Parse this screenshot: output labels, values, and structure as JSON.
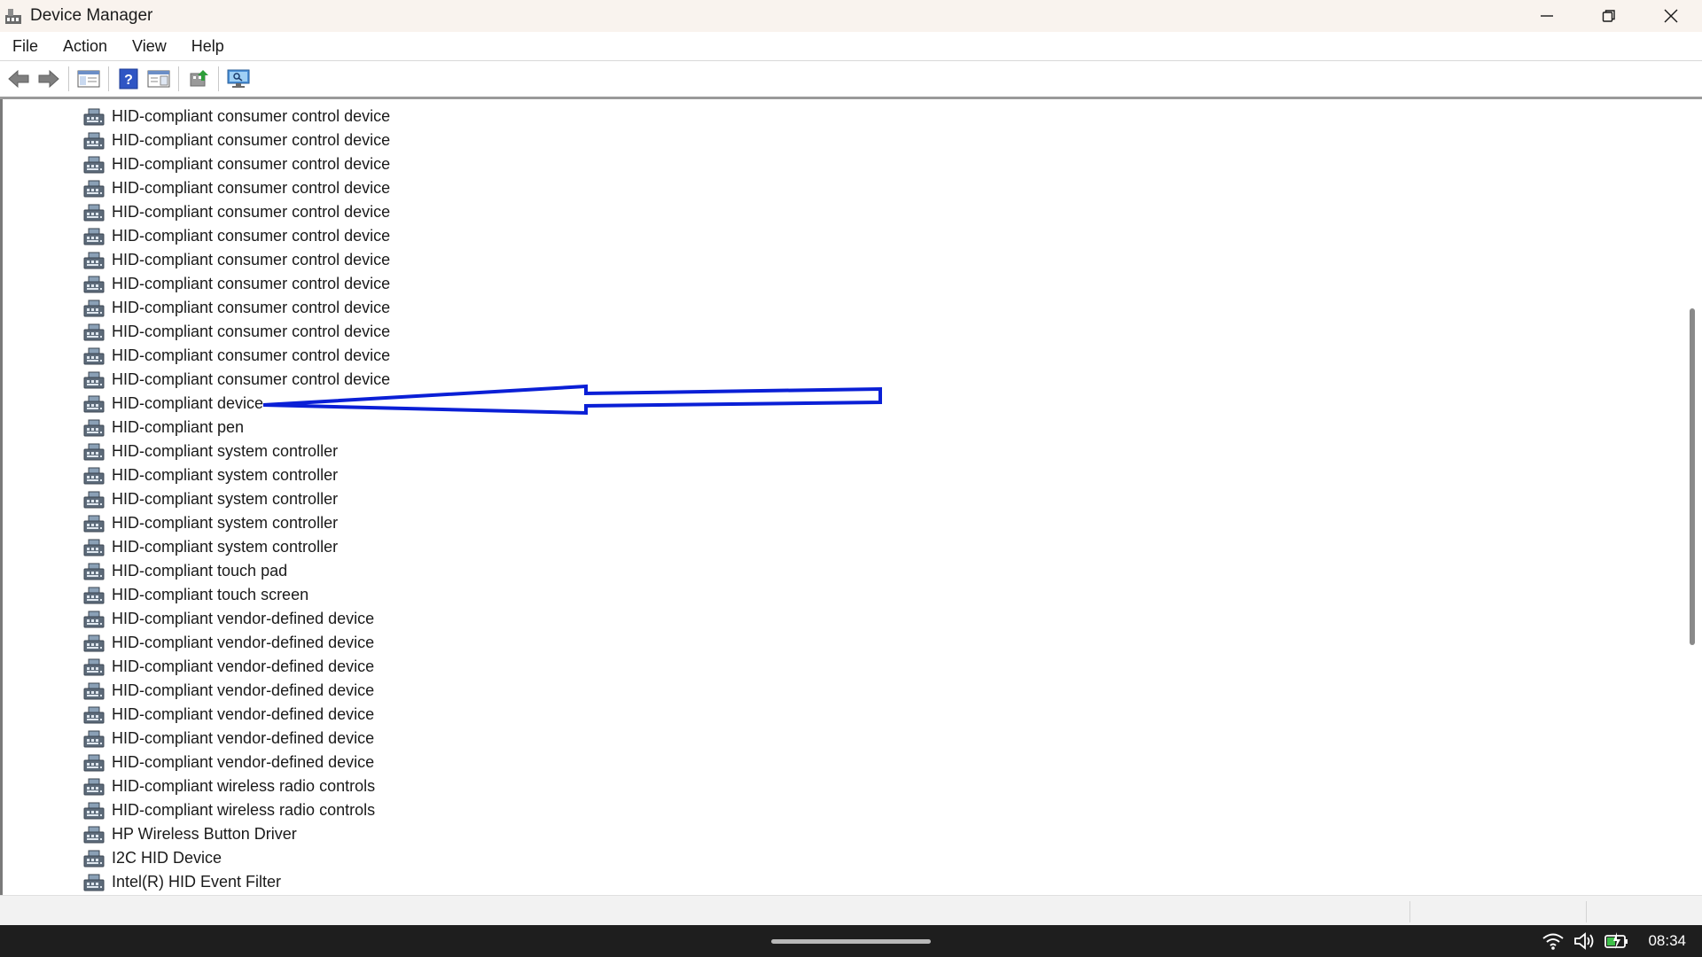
{
  "window": {
    "title": "Device Manager"
  },
  "menu": [
    "File",
    "Action",
    "View",
    "Help"
  ],
  "toolbar_icons": [
    "back-arrow-icon",
    "forward-arrow-icon",
    "show-hide-console-tree-icon",
    "help-icon",
    "properties-view-icon",
    "update-driver-icon",
    "scan-hardware-changes-icon"
  ],
  "devices": [
    "HID-compliant consumer control device",
    "HID-compliant consumer control device",
    "HID-compliant consumer control device",
    "HID-compliant consumer control device",
    "HID-compliant consumer control device",
    "HID-compliant consumer control device",
    "HID-compliant consumer control device",
    "HID-compliant consumer control device",
    "HID-compliant consumer control device",
    "HID-compliant consumer control device",
    "HID-compliant consumer control device",
    "HID-compliant consumer control device",
    "HID-compliant device",
    "HID-compliant pen",
    "HID-compliant system controller",
    "HID-compliant system controller",
    "HID-compliant system controller",
    "HID-compliant system controller",
    "HID-compliant system controller",
    "HID-compliant touch pad",
    "HID-compliant touch screen",
    "HID-compliant vendor-defined device",
    "HID-compliant vendor-defined device",
    "HID-compliant vendor-defined device",
    "HID-compliant vendor-defined device",
    "HID-compliant vendor-defined device",
    "HID-compliant vendor-defined device",
    "HID-compliant vendor-defined device",
    "HID-compliant wireless radio controls",
    "HID-compliant wireless radio controls",
    "HP Wireless Button Driver",
    "I2C HID Device",
    "Intel(R) HID Event Filter"
  ],
  "annotation": {
    "color": "#0a1fd6"
  },
  "taskbar": {
    "clock": "08:34"
  },
  "colors": {
    "titlebar_bg": "#f9f3ee",
    "taskbar_bg": "#1e1e1e",
    "icon_blue": "#2f6fc8"
  }
}
